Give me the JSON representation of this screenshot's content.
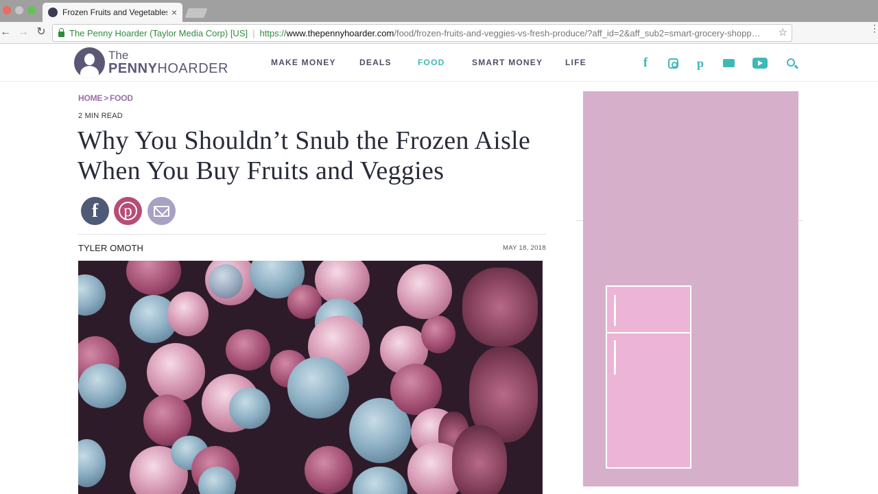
{
  "browser": {
    "tab_title": "Frozen Fruits and Vegetables",
    "tab_title_fade": "—",
    "tab_close": "×",
    "secure_label": "The Penny Hoarder (Taylor Media Corp) [US]",
    "url_scheme": "https://",
    "url_host": "www.thepennyhoarder.com",
    "url_path": "/food/frozen-fruits-and-veggies-vs-fresh-produce/?aff_id=2&aff_sub2=smart-grocery-shopp…",
    "back_icon": "←",
    "forward_icon": "→",
    "reload_icon": "↻",
    "star_icon": "☆",
    "menu_icon": "⋮"
  },
  "site": {
    "logo_the": "The",
    "logo_penny": "PENNY",
    "logo_hoarder": "HOARDER",
    "nav": {
      "make_money": "MAKE MONEY",
      "deals": "DEALS",
      "food": "FOOD",
      "smart_money": "SMART MONEY",
      "life": "LIFE"
    },
    "social": {
      "facebook_glyph": "f",
      "pinterest_glyph": "p"
    },
    "accent_color": "#3fb8b8",
    "brand_color": "#5b5876"
  },
  "article": {
    "breadcrumb_home": "HOME",
    "breadcrumb_sep": ">",
    "breadcrumb_section": "FOOD",
    "read_time": "2 MIN READ",
    "headline": "Why You Shouldn’t Snub the Frozen Aisle When You Buy Fruits and Veggies",
    "share": {
      "facebook_glyph": "f",
      "pinterest_glyph": "p"
    },
    "author": "TYLER OMOTH",
    "date": "MAY 18, 2018"
  }
}
